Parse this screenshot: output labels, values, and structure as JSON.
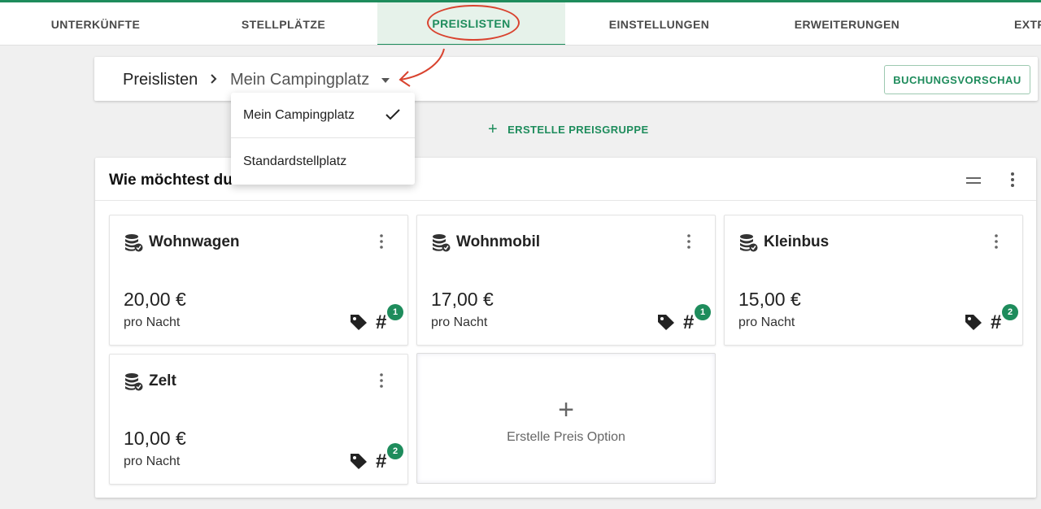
{
  "nav": {
    "tabs": [
      {
        "label": "UNTERKÜNFTE"
      },
      {
        "label": "STELLPLÄTZE"
      },
      {
        "label": "PREISLISTEN"
      },
      {
        "label": "EINSTELLUNGEN"
      },
      {
        "label": "ERWEITERUNGEN"
      },
      {
        "label": "EXTR"
      }
    ],
    "active_tab": "PREISLISTEN"
  },
  "header": {
    "breadcrumb_root": "Preislisten",
    "breadcrumb_current": "Mein Campingplatz",
    "preview_button": "BUCHUNGSVORSCHAU"
  },
  "dropdown": {
    "items": [
      {
        "label": "Mein Campingplatz",
        "selected": true
      },
      {
        "label": "Standardstellplatz",
        "selected": false
      }
    ]
  },
  "create_group_label": "ERSTELLE PREISGRUPPE",
  "group": {
    "title": "Wie möchtest du",
    "cards": [
      {
        "name": "Wohnwagen",
        "price": "20,00 €",
        "unit": "pro Nacht",
        "badge": "1"
      },
      {
        "name": "Wohnmobil",
        "price": "17,00 €",
        "unit": "pro Nacht",
        "badge": "1"
      },
      {
        "name": "Kleinbus",
        "price": "15,00 €",
        "unit": "pro Nacht",
        "badge": "2"
      },
      {
        "name": "Zelt",
        "price": "10,00 €",
        "unit": "pro Nacht",
        "badge": "2"
      }
    ],
    "add_option_label": "Erstelle Preis Option",
    "hash_symbol": "#",
    "add_symbol": "+",
    "create_symbol": "+"
  },
  "colors": {
    "accent": "#1e8c5c",
    "active_tab_bg": "#e6f2ea",
    "annotation": "#d9432f",
    "background": "#f0f0f0"
  },
  "icons": [
    "coins-check-icon",
    "more-vert-icon",
    "tag-icon",
    "hash-icon",
    "plus-icon",
    "chevron-right-icon",
    "caret-down-icon",
    "check-icon",
    "drag-handle-icon"
  ]
}
